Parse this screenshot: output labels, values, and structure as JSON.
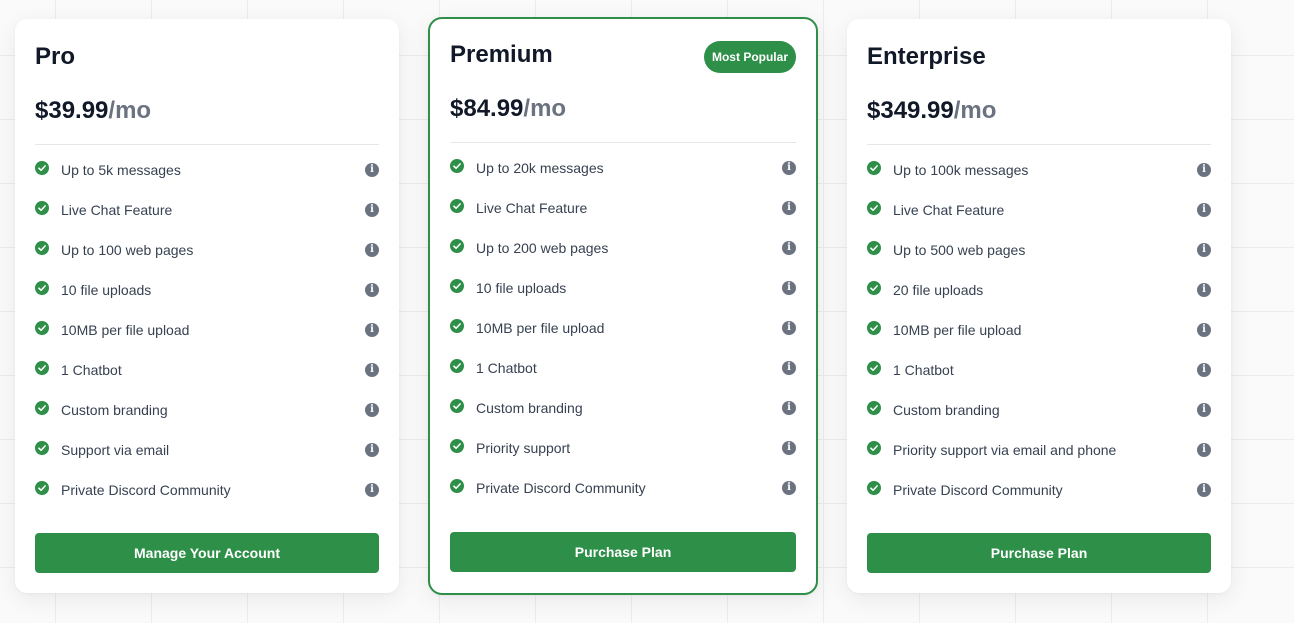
{
  "colors": {
    "accent": "#2e8f48",
    "info": "#6b7280"
  },
  "plans": [
    {
      "name": "Pro",
      "badge": "",
      "price": "$39.99",
      "per": "/mo",
      "features": [
        "Up to 5k messages",
        "Live Chat Feature",
        "Up to 100 web pages",
        "10 file uploads",
        "10MB per file upload",
        "1 Chatbot",
        "Custom branding",
        "Support via email",
        "Private Discord Community"
      ],
      "cta": "Manage Your Account"
    },
    {
      "name": "Premium",
      "badge": "Most Popular",
      "price": "$84.99",
      "per": "/mo",
      "features": [
        "Up to 20k messages",
        "Live Chat Feature",
        "Up to 200 web pages",
        "10 file uploads",
        "10MB per file upload",
        "1 Chatbot",
        "Custom branding",
        "Priority support",
        "Private Discord Community"
      ],
      "cta": "Purchase Plan"
    },
    {
      "name": "Enterprise",
      "badge": "",
      "price": "$349.99",
      "per": "/mo",
      "features": [
        "Up to 100k messages",
        "Live Chat Feature",
        "Up to 500 web pages",
        "20 file uploads",
        "10MB per file upload",
        "1 Chatbot",
        "Custom branding",
        "Priority support via email and phone",
        "Private Discord Community"
      ],
      "cta": "Purchase Plan"
    }
  ]
}
